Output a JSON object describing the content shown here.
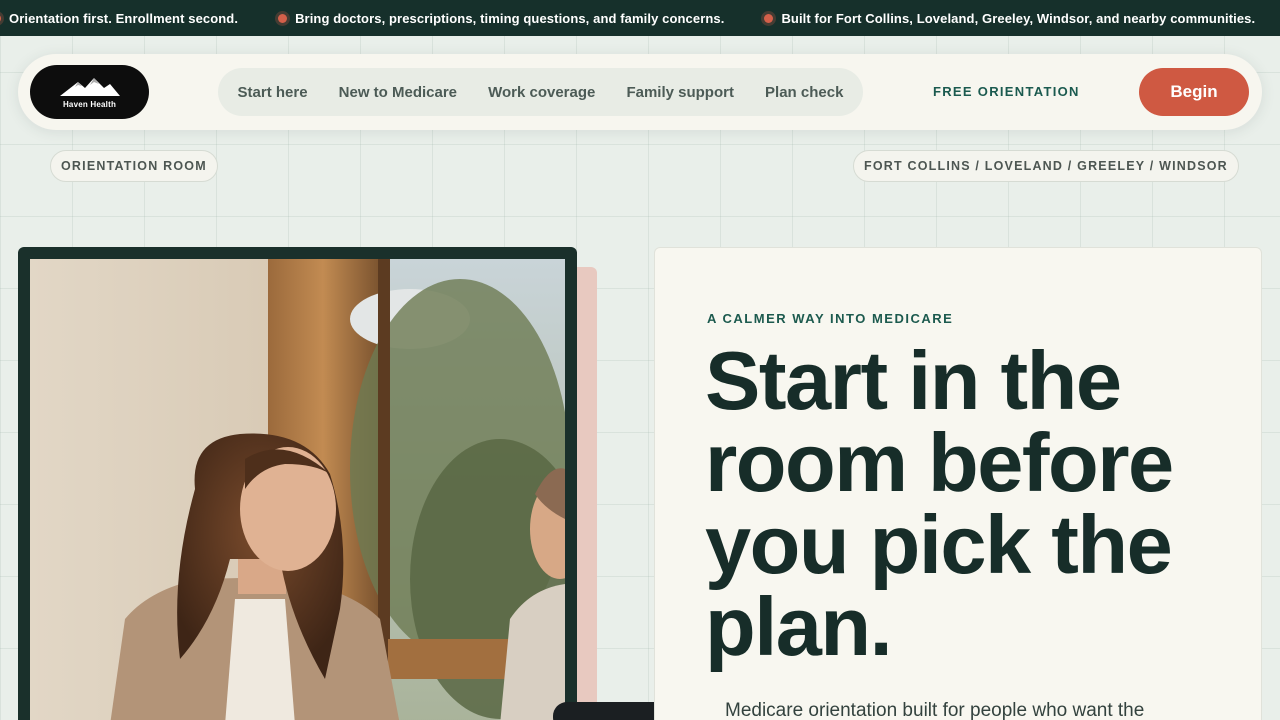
{
  "ticker": {
    "items": [
      "Orientation first. Enrollment second.",
      "Bring doctors, prescriptions, timing questions, and family concerns.",
      "Built for Fort Collins, Loveland, Greeley, Windsor, and nearby communities."
    ]
  },
  "header": {
    "logo_text": "Haven Health",
    "nav": [
      "Start here",
      "New to Medicare",
      "Work coverage",
      "Family support",
      "Plan check"
    ],
    "free_link": "FREE ORIENTATION",
    "cta": "Begin"
  },
  "tags": {
    "left": "ORIENTATION ROOM",
    "right": "FORT COLLINS / LOVELAND / GREELEY / WINDSOR"
  },
  "hero": {
    "eyebrow": "A CALMER WAY INTO MEDICARE",
    "headline": "Start in the room before you pick the plan.",
    "lede": "Medicare orientation built for people who want the"
  },
  "colors": {
    "ticker_bg": "#16302b",
    "accent": "#cf5942",
    "brand_green": "#1b5a4f",
    "headline": "#172d29"
  }
}
